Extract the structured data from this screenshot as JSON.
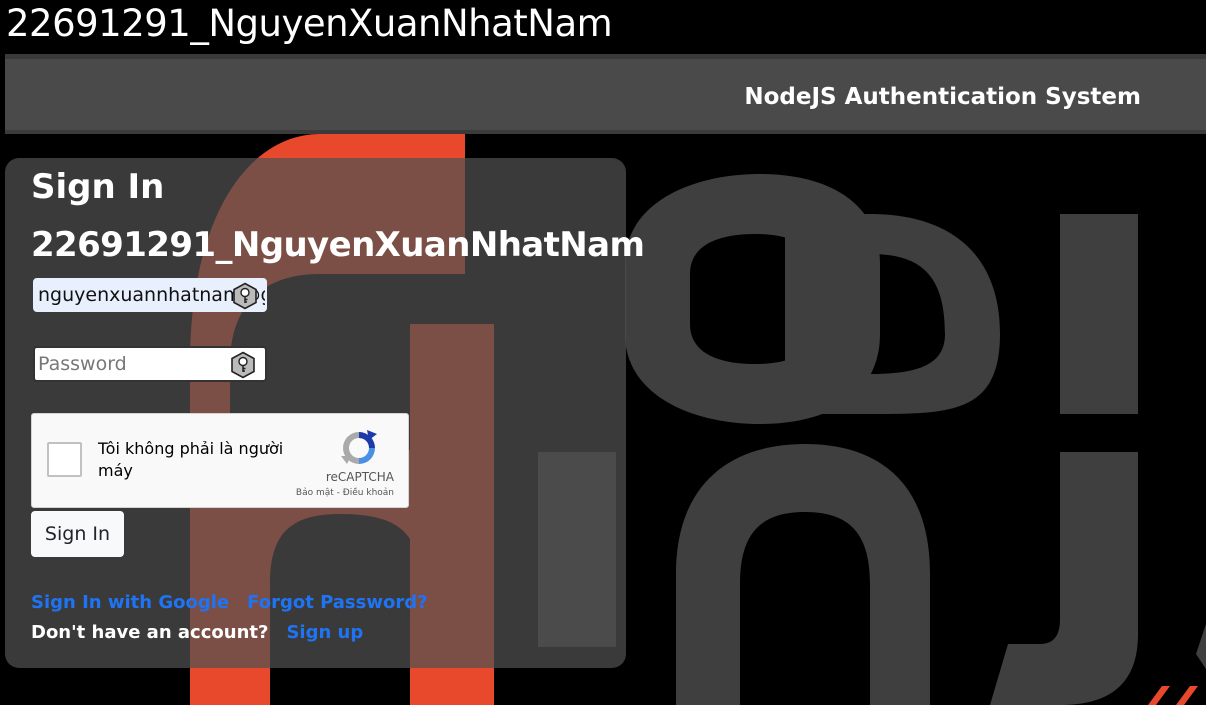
{
  "window": {
    "title": "22691291_NguyenXuanNhatNam"
  },
  "navbar": {
    "brand": "NodeJS Authentication System"
  },
  "form": {
    "title": "Sign In",
    "subtitle": "22691291_NguyenXuanNhatNam",
    "email_value": "nguyenxuannhatnam@gmail.com",
    "password_placeholder": "Password",
    "submit_label": "Sign In"
  },
  "recaptcha": {
    "label": "Tôi không phải là người máy",
    "brand": "reCAPTCHA",
    "privacy": "Bảo mật",
    "separator": " - ",
    "terms": "Điều khoản"
  },
  "links": {
    "google": "Sign In with Google",
    "forgot": "Forgot Password?",
    "no_account": "Don't have an account?",
    "signup": "Sign up"
  },
  "background_art": {
    "letters_top": "ODI",
    "letters_bottom": "NJ"
  },
  "colors": {
    "accent_link": "#1e74f4",
    "navbar": "#4a4a4a",
    "art_orange": "#e8482b",
    "art_gray": "#3f3f3f"
  },
  "icons": [
    "key-icon",
    "recaptcha-logo-icon"
  ]
}
